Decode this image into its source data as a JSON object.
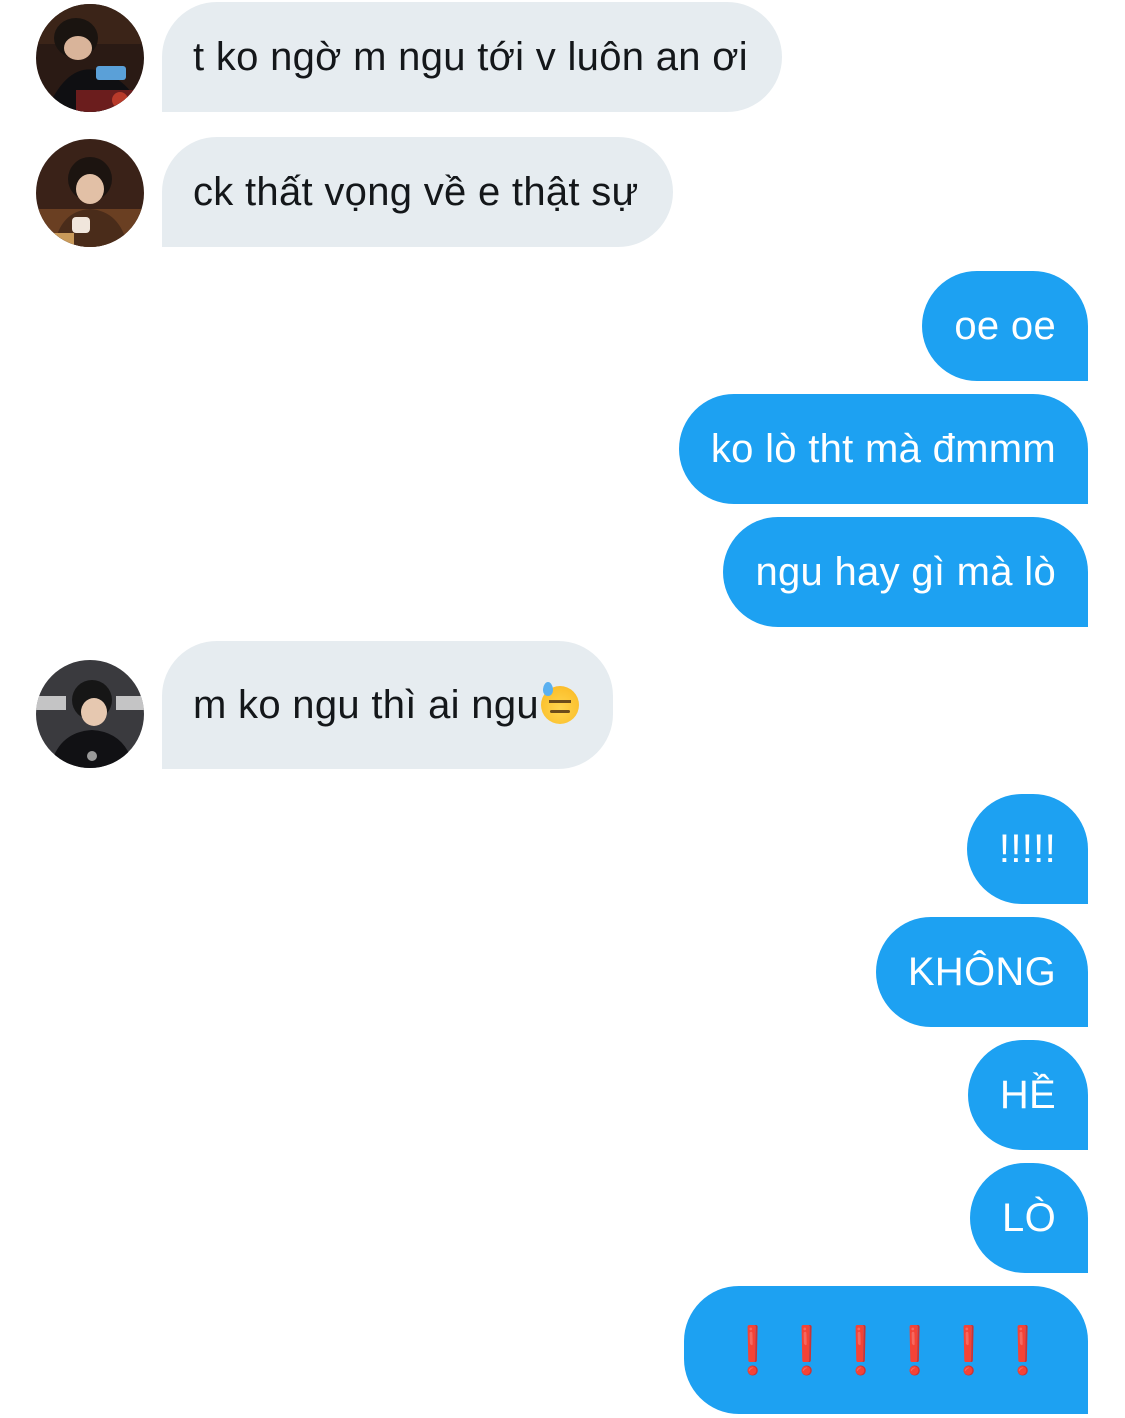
{
  "messages": [
    {
      "side": "incoming",
      "text": "t ko ngờ m ngu tới v luôn an ơi"
    },
    {
      "side": "incoming",
      "text": "ck thất vọng về e thật sự"
    },
    {
      "side": "outgoing",
      "text": "oe oe"
    },
    {
      "side": "outgoing",
      "text": "ko lò tht mà đmmm"
    },
    {
      "side": "outgoing",
      "text": "ngu hay gì mà lò"
    },
    {
      "side": "incoming",
      "text": "m ko ngu thì ai ngu",
      "emoji": "downcast-face-with-sweat"
    },
    {
      "side": "outgoing",
      "text": "!!!!!"
    },
    {
      "side": "outgoing",
      "text": "KHÔNG"
    },
    {
      "side": "outgoing",
      "text": "HỀ"
    },
    {
      "side": "outgoing",
      "text": "LÒ"
    },
    {
      "side": "outgoing",
      "marks": [
        "❗",
        "❗",
        "❗",
        "❗",
        "❗",
        "❗"
      ]
    }
  ],
  "colors": {
    "incoming_bubble": "#e6ecf0",
    "outgoing_bubble": "#1da1f2",
    "incoming_text": "#14171a",
    "outgoing_text": "#ffffff",
    "red_mark": "#e0141e"
  }
}
